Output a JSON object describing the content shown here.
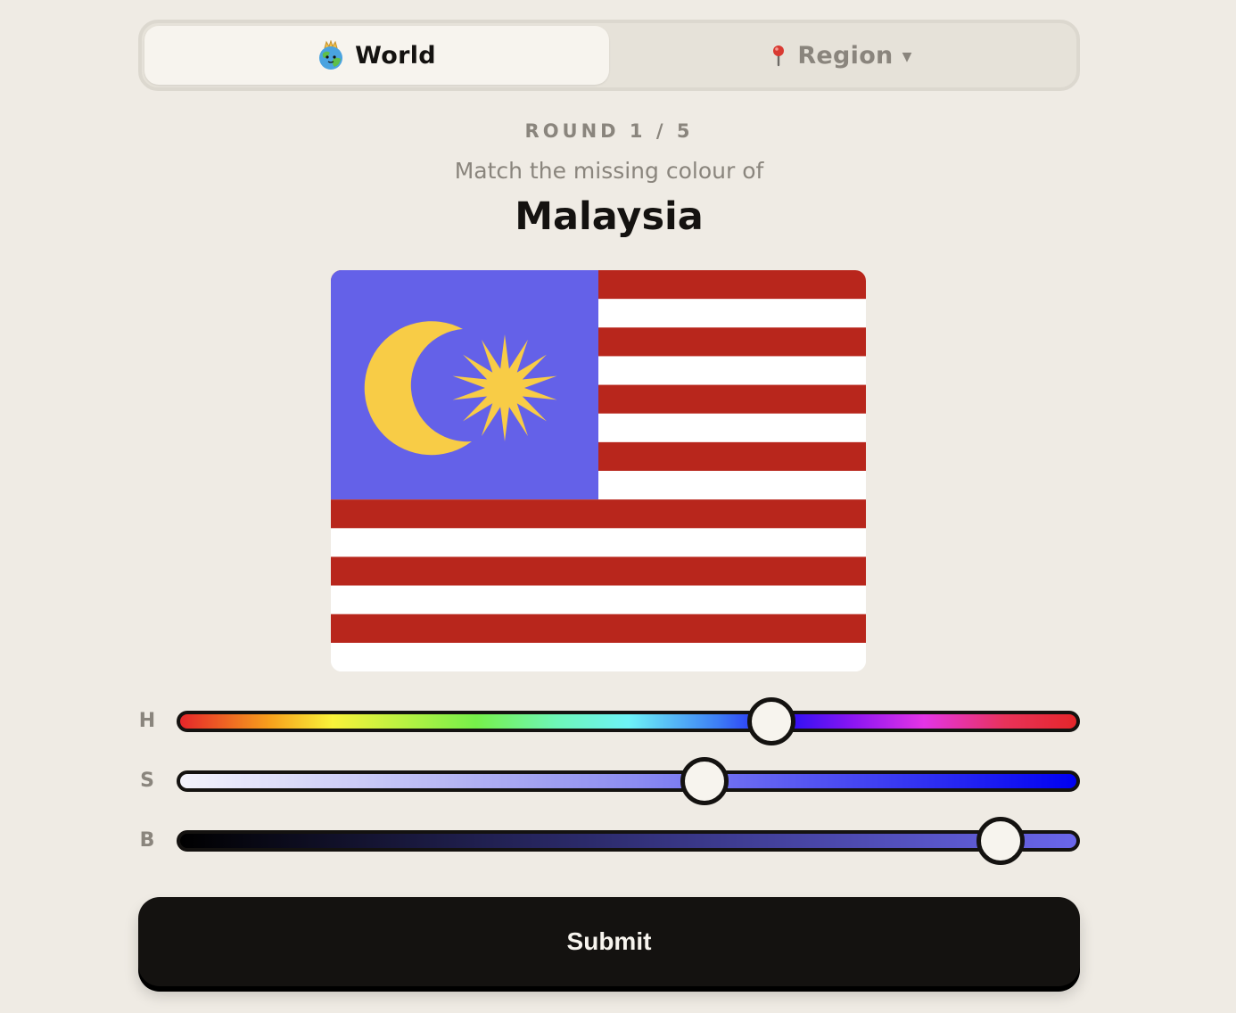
{
  "mode_switch": {
    "tabs": [
      {
        "label": "World",
        "icon": "globe-icon",
        "active": true
      },
      {
        "label": "Region",
        "icon": "pin-icon",
        "dropdown_icon": "caret-down-icon",
        "active": false
      }
    ]
  },
  "game": {
    "round_label": "ROUND 1 / 5",
    "prompt": "Match the missing colour of",
    "country": "Malaysia"
  },
  "flag": {
    "canton_color": "#6461e8",
    "stripe_red": "#b8261c",
    "stripe_white": "#ffffff",
    "emblem_color": "#f8cc46"
  },
  "sliders": [
    {
      "letter": "H",
      "name": "hue",
      "value_fraction": 0.66
    },
    {
      "letter": "S",
      "name": "saturation",
      "value_fraction": 0.585
    },
    {
      "letter": "B",
      "name": "brightness",
      "value_fraction": 0.915
    }
  ],
  "submit": {
    "label": "Submit"
  },
  "colors": {
    "background": "#efebe4",
    "ink": "#141210",
    "muted": "#8a857d"
  }
}
